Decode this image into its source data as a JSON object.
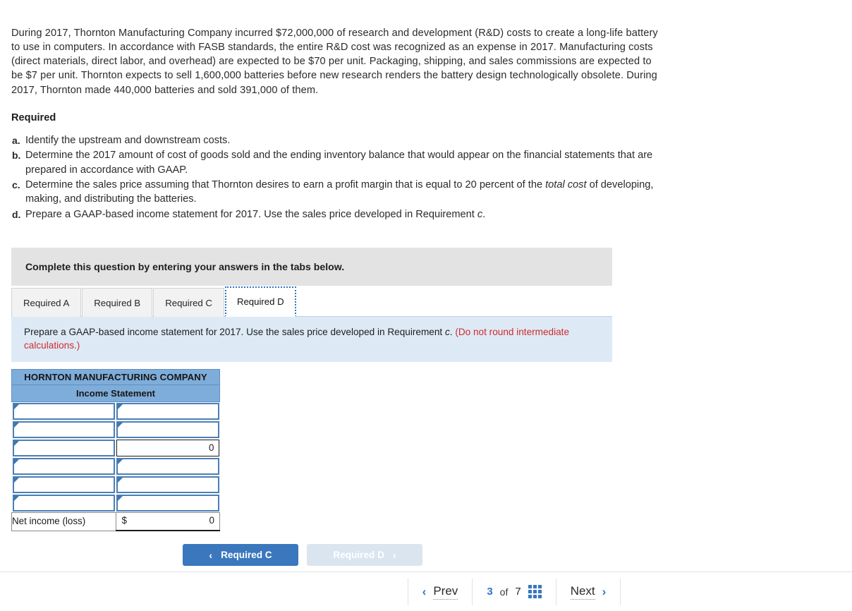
{
  "problem": {
    "stem": "During 2017, Thornton Manufacturing Company incurred $72,000,000 of research and development (R&D) costs to create a long-life battery to use in computers. In accordance with FASB standards, the entire R&D cost was recognized as an expense in 2017. Manufacturing costs (direct materials, direct labor, and overhead) are expected to be $70 per unit. Packaging, shipping, and sales commissions are expected to be $7 per unit. Thornton expects to sell 1,600,000 batteries before new research renders the battery design technologically obsolete. During 2017, Thornton made 440,000 batteries and sold 391,000 of them.",
    "required_heading": "Required",
    "requirements": [
      {
        "marker": "a.",
        "text": "Identify the upstream and downstream costs."
      },
      {
        "marker": "b.",
        "text": "Determine the 2017 amount of cost of goods sold and the ending inventory balance that would appear on the financial statements that are prepared in accordance with GAAP."
      },
      {
        "marker": "c.",
        "text_before": "Determine the sales price assuming that Thornton desires to earn a profit margin that is equal to 20 percent of the ",
        "italic": "total cost",
        "text_after": " of developing, making, and distributing the batteries."
      },
      {
        "marker": "d.",
        "text_before": "Prepare a GAAP-based income statement for 2017. Use the sales price developed in Requirement ",
        "italic": "c",
        "text_after": "."
      }
    ]
  },
  "answer_panel": {
    "grey_banner": "Complete this question by entering your answers in the tabs below.",
    "tabs": [
      {
        "label": "Required A",
        "active": false
      },
      {
        "label": "Required B",
        "active": false
      },
      {
        "label": "Required C",
        "active": false
      },
      {
        "label": "Required D",
        "active": true
      }
    ],
    "blue_banner": {
      "text_before": "Prepare a GAAP-based income statement for 2017. Use the sales price developed in Requirement ",
      "italic": "c",
      "text_mid": ". ",
      "warning": "(Do not round intermediate calculations.)"
    },
    "income_statement": {
      "company": "HORNTON MANUFACTURING COMPANY",
      "statement_title": "Income Statement",
      "rows": [
        {
          "label": "",
          "label_type": "input",
          "amount": "",
          "amount_type": "input"
        },
        {
          "label": "",
          "label_type": "input",
          "amount": "",
          "amount_type": "input"
        },
        {
          "label": "",
          "label_type": "input",
          "amount": "0",
          "amount_type": "computed"
        },
        {
          "label": "",
          "label_type": "input",
          "amount": "",
          "amount_type": "input"
        },
        {
          "label": "",
          "label_type": "input",
          "amount": "",
          "amount_type": "input"
        },
        {
          "label": "",
          "label_type": "input",
          "amount": "",
          "amount_type": "input"
        }
      ],
      "total_row": {
        "label": "Net income (loss)",
        "currency": "$",
        "amount": "0"
      }
    },
    "buttons": {
      "prev": {
        "label": "Required C",
        "chevron": "‹",
        "state": "enabled"
      },
      "next": {
        "label": "Required D",
        "chevron": "›",
        "state": "disabled"
      }
    }
  },
  "pager": {
    "prev_label": "Prev",
    "prev_chevron": "‹",
    "current_page": "3",
    "of_label": "of",
    "total_pages": "7",
    "grid_icon": "grid-icon",
    "next_label": "Next",
    "next_chevron": "›"
  },
  "colors": {
    "accent_blue": "#3b77bd",
    "table_header_blue": "#7fadda",
    "blue_banner_bg": "#ddeaf6",
    "grey_banner_bg": "#e3e3e3",
    "warning_red": "#d22b2b"
  }
}
